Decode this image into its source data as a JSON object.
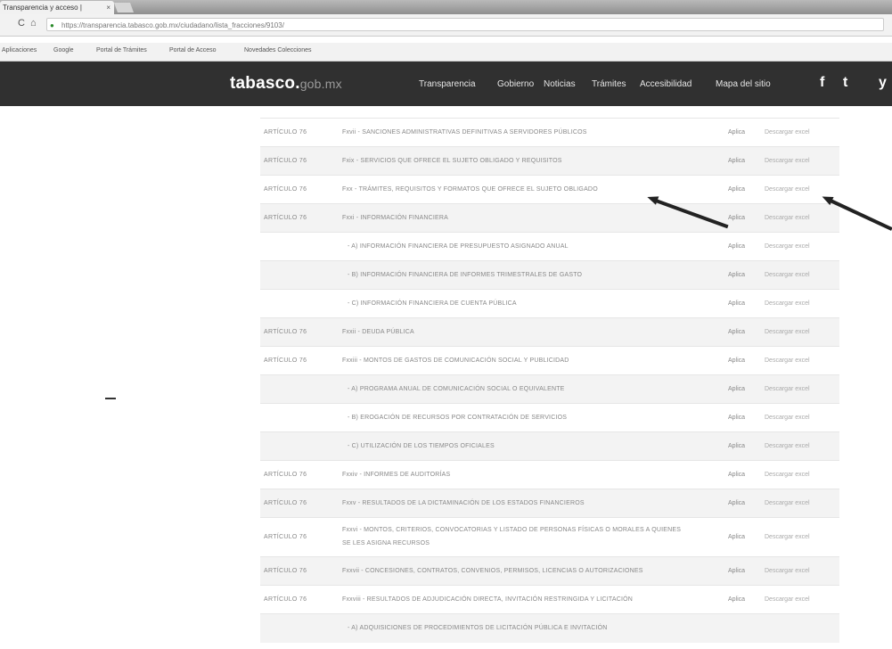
{
  "browser": {
    "tab_title": "Transparencia y acceso |",
    "tab_close": "×",
    "url": "https://transparencia.tabasco.gob.mx/ciudadano/lista_fracciones/9103/",
    "back": "C",
    "home": "⌂",
    "bookmarks": [
      "Aplicaciones",
      "Google",
      "Portal de Trámites",
      "Portal de Acceso",
      "Novedades Colecciones"
    ]
  },
  "site": {
    "logo_main": "tabasco.",
    "logo_sub": "gob.mx",
    "menu": [
      "Transparencia",
      "Gobierno",
      "Noticias",
      "Trámites",
      "Accesibilidad",
      "Mapa del sitio"
    ],
    "social": [
      "f",
      "t",
      "y"
    ]
  },
  "table": {
    "rows": [
      {
        "art": "ARTÍCULO 76",
        "frac": "Fxvii - SANCIONES ADMINISTRATIVAS DEFINITIVAS A SERVIDORES PÚBLICOS",
        "indent": false,
        "aplica": "Aplica",
        "desc": "Descargar excel",
        "shaded": false
      },
      {
        "art": "ARTÍCULO 76",
        "frac": "Fxix - SERVICIOS QUE OFRECE EL SUJETO OBLIGADO Y REQUISITOS",
        "indent": false,
        "aplica": "Aplica",
        "desc": "Descargar excel",
        "shaded": true
      },
      {
        "art": "ARTÍCULO 76",
        "frac": "Fxx - TRÁMITES, REQUISITOS Y FORMATOS QUE OFRECE EL SUJETO OBLIGADO",
        "indent": false,
        "aplica": "Aplica",
        "desc": "Descargar excel",
        "shaded": false
      },
      {
        "art": "ARTÍCULO 76",
        "frac": "Fxxi - INFORMACIÓN FINANCIERA",
        "indent": false,
        "aplica": "Aplica",
        "desc": "Descargar excel",
        "shaded": true
      },
      {
        "art": "",
        "frac": "- A) INFORMACIÓN FINANCIERA DE PRESUPUESTO ASIGNADO ANUAL",
        "indent": true,
        "aplica": "Aplica",
        "desc": "Descargar excel",
        "shaded": false
      },
      {
        "art": "",
        "frac": "- B) INFORMACIÓN FINANCIERA DE INFORMES TRIMESTRALES DE GASTO",
        "indent": true,
        "aplica": "Aplica",
        "desc": "Descargar excel",
        "shaded": true
      },
      {
        "art": "",
        "frac": "- C) INFORMACIÓN FINANCIERA DE CUENTA PÚBLICA",
        "indent": true,
        "aplica": "Aplica",
        "desc": "Descargar excel",
        "shaded": false
      },
      {
        "art": "ARTÍCULO 76",
        "frac": "Fxxii - DEUDA PÚBLICA",
        "indent": false,
        "aplica": "Aplica",
        "desc": "Descargar excel",
        "shaded": true
      },
      {
        "art": "ARTÍCULO 76",
        "frac": "Fxxiii - MONTOS DE GASTOS DE COMUNICACIÓN SOCIAL Y PUBLICIDAD",
        "indent": false,
        "aplica": "Aplica",
        "desc": "Descargar excel",
        "shaded": false
      },
      {
        "art": "",
        "frac": "- A) PROGRAMA ANUAL DE COMUNICACIÓN SOCIAL O EQUIVALENTE",
        "indent": true,
        "aplica": "Aplica",
        "desc": "Descargar excel",
        "shaded": true
      },
      {
        "art": "",
        "frac": "- B) EROGACIÓN DE RECURSOS POR CONTRATACIÓN DE SERVICIOS",
        "indent": true,
        "aplica": "Aplica",
        "desc": "Descargar excel",
        "shaded": false
      },
      {
        "art": "",
        "frac": "- C) UTILIZACIÓN DE LOS TIEMPOS OFICIALES",
        "indent": true,
        "aplica": "Aplica",
        "desc": "Descargar excel",
        "shaded": true
      },
      {
        "art": "ARTÍCULO 76",
        "frac": "Fxxiv - INFORMES DE AUDITORÍAS",
        "indent": false,
        "aplica": "Aplica",
        "desc": "Descargar excel",
        "shaded": false
      },
      {
        "art": "ARTÍCULO 76",
        "frac": "Fxxv - RESULTADOS DE LA DICTAMINACIÓN DE LOS ESTADOS FINANCIEROS",
        "indent": false,
        "aplica": "Aplica",
        "desc": "Descargar excel",
        "shaded": true
      },
      {
        "art": "ARTÍCULO 76",
        "frac": "Fxxvi - MONTOS, CRITERIOS, CONVOCATORIAS Y LISTADO DE PERSONAS FÍSICAS O MORALES A QUIENES SE LES ASIGNA RECURSOS",
        "indent": false,
        "aplica": "Aplica",
        "desc": "Descargar excel",
        "shaded": false,
        "tall": true
      },
      {
        "art": "ARTÍCULO 76",
        "frac": "Fxxvii - CONCESIONES, CONTRATOS, CONVENIOS, PERMISOS, LICENCIAS O AUTORIZACIONES",
        "indent": false,
        "aplica": "Aplica",
        "desc": "Descargar excel",
        "shaded": true
      },
      {
        "art": "ARTÍCULO 76",
        "frac": "Fxxviii - RESULTADOS DE ADJUDICACIÓN DIRECTA, INVITACIÓN RESTRINGIDA Y LICITACIÓN",
        "indent": false,
        "aplica": "Aplica",
        "desc": "Descargar excel",
        "shaded": false
      },
      {
        "art": "",
        "frac": "- A) ADQUISICIONES DE PROCEDIMIENTOS DE LICITACIÓN PÚBLICA E INVITACIÓN",
        "indent": true,
        "aplica": "",
        "desc": "",
        "shaded": true
      }
    ]
  }
}
